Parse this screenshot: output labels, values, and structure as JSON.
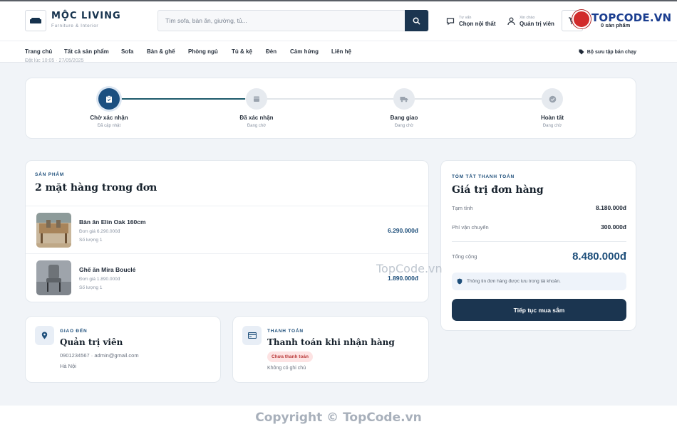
{
  "brand": {
    "name": "MỘC LIVING",
    "tagline": "Furniture & Interior"
  },
  "search": {
    "placeholder": "Tìm sofa, bàn ăn, giường, tủ..."
  },
  "header": {
    "advice_small": "Tư vấn",
    "advice_big": "Chọn nội thất",
    "account_small": "Xin chào",
    "account_big": "Quản trị viên",
    "cart_label": "0 sản phẩm"
  },
  "watermark": {
    "logo_text": "TOPCODE.VN",
    "mid_text": "TopCode.vn",
    "copyright": "Copyright © TopCode.vn"
  },
  "nav": {
    "items": [
      "Trang chủ",
      "Tất cả sản phẩm",
      "Sofa",
      "Bàn & ghế",
      "Phòng ngủ",
      "Tủ & kệ",
      "Đèn",
      "Cảm hứng",
      "Liên hệ"
    ],
    "right_label": "Bộ sưu tập bán chạy"
  },
  "order_meta_partial": "Đặt lúc 10:05 · 27/05/2025",
  "progress": {
    "steps": [
      {
        "label": "Chờ xác nhận",
        "sub": "Đã cập nhật",
        "state": "active"
      },
      {
        "label": "Đã xác nhận",
        "sub": "Đang chờ",
        "state": "pending"
      },
      {
        "label": "Đang giao",
        "sub": "Đang chờ",
        "state": "pending"
      },
      {
        "label": "Hoàn tất",
        "sub": "Đang chờ",
        "state": "pending"
      }
    ]
  },
  "products": {
    "kicker": "Sản phẩm",
    "title": "2 mặt hàng trong đơn",
    "items": [
      {
        "name": "Bàn ăn Elin Oak 160cm",
        "unit_price": "Đơn giá 6.290.000đ",
        "qty": "Số lượng 1",
        "total": "6.290.000đ"
      },
      {
        "name": "Ghế ăn Mira Bouclé",
        "unit_price": "Đơn giá 1.890.000đ",
        "qty": "Số lượng 1",
        "total": "1.890.000đ"
      }
    ]
  },
  "summary": {
    "kicker": "Tóm tắt thanh toán",
    "title": "Giá trị đơn hàng",
    "subtotal_label": "Tạm tính",
    "subtotal_value": "8.180.000đ",
    "shipping_label": "Phí vận chuyển",
    "shipping_value": "300.000đ",
    "total_label": "Tổng cộng",
    "total_value": "8.480.000đ",
    "note": "Thông tin đơn hàng được lưu trong tài khoản.",
    "cta": "Tiếp tục mua sắm"
  },
  "shipping": {
    "kicker": "Giao đến",
    "name": "Quản trị viên",
    "contact": "0901234567 · admin@gmail.com",
    "city": "Hà Nội"
  },
  "payment": {
    "kicker": "Thanh toán",
    "method": "Thanh toán khi nhận hàng",
    "status": "Chưa thanh toán",
    "note": "Không có ghi chú"
  },
  "colors": {
    "primary": "#1b3550",
    "accent": "#1d4e7a",
    "background": "#f1f4f8",
    "unpaid_badge": "#fde3e3"
  }
}
